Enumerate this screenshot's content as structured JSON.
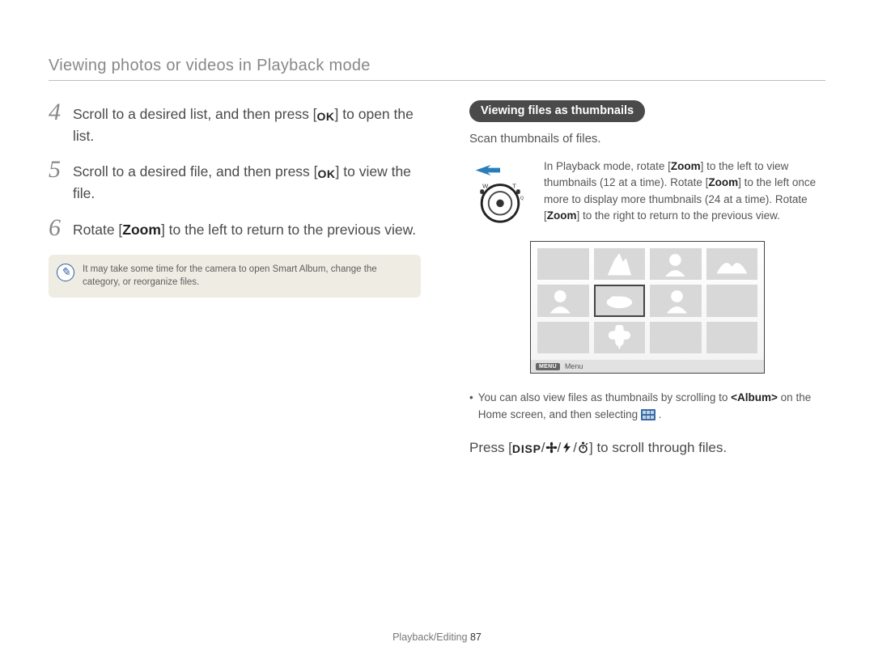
{
  "header": "Viewing photos or videos in Playback mode",
  "steps": [
    {
      "num": "4",
      "pre": "Scroll to a desired list, and then press [",
      "btn": "OK",
      "post": "] to open the list."
    },
    {
      "num": "5",
      "pre": "Scroll to a desired file, and then press [",
      "btn": "OK",
      "post": "] to view the file."
    },
    {
      "num": "6",
      "pre": "Rotate [",
      "bold": "Zoom",
      "post": "] to the left to return to the previous view."
    }
  ],
  "note": "It may take some time for the camera to open Smart Album, change the category, or reorganize files.",
  "pill": "Viewing files as thumbnails",
  "rt_sub": "Scan thumbnails of files.",
  "rt_desc": {
    "a": "In Playback mode, rotate [",
    "z1": "Zoom",
    "b": "] to the left to view thumbnails (12 at a time). Rotate [",
    "z2": "Zoom",
    "c": "] to the left once more to display more thumbnails (24 at a time). Rotate [",
    "z3": "Zoom",
    "d": "] to the right to return to the previous view."
  },
  "menu_label": "Menu",
  "menu_chip": "MENU",
  "bullet": {
    "a": "You can also view files as thumbnails by scrolling to ",
    "album": "<Album>",
    "b": " on the Home screen, and then selecting ",
    "c": " ."
  },
  "press_line": {
    "a": "Press [",
    "disp": "DISP",
    "b": "] to scroll through files."
  },
  "footer": {
    "section": "Playback/Editing  ",
    "page": "87"
  }
}
